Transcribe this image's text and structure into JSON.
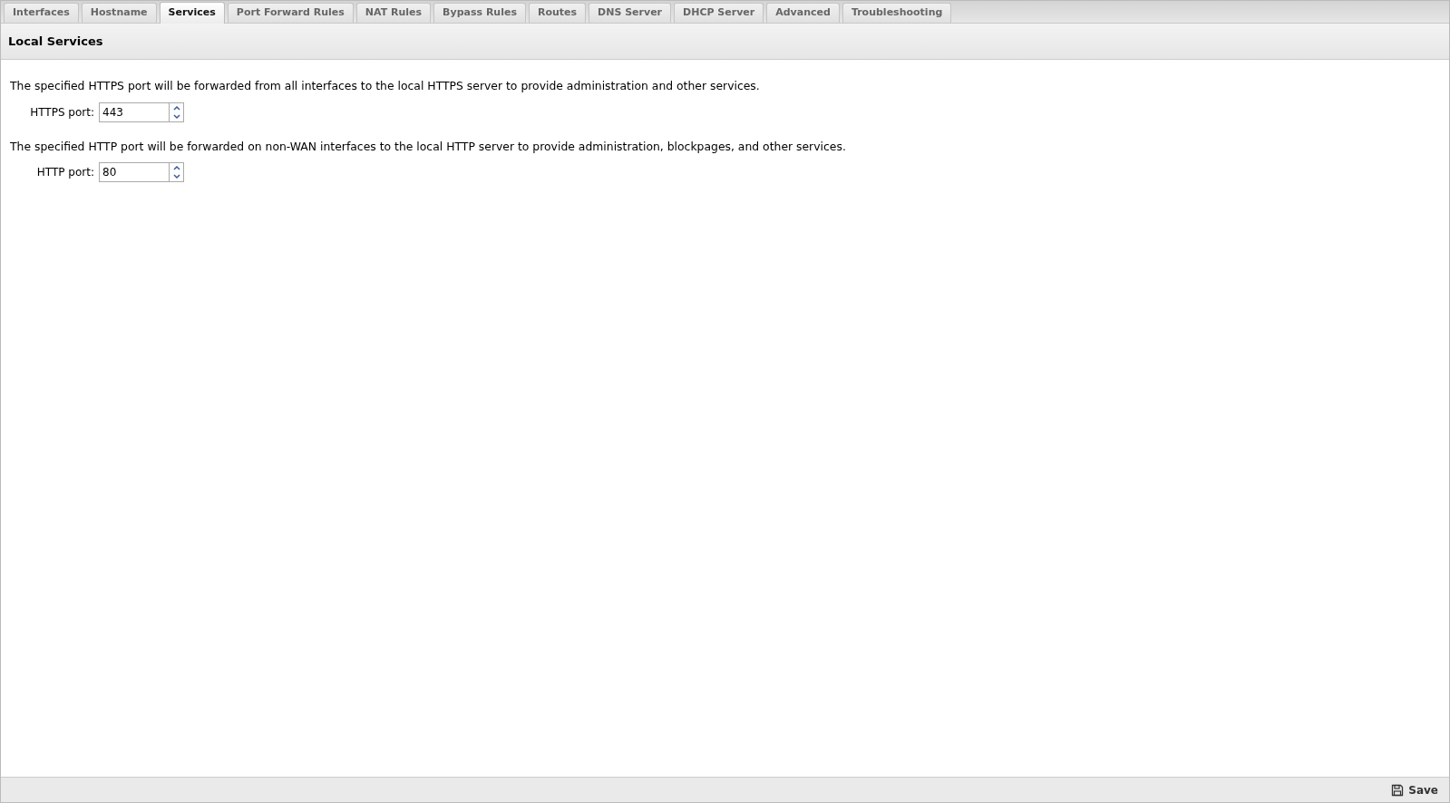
{
  "tabs": [
    {
      "label": "Interfaces",
      "selected": false
    },
    {
      "label": "Hostname",
      "selected": false
    },
    {
      "label": "Services",
      "selected": true
    },
    {
      "label": "Port Forward Rules",
      "selected": false
    },
    {
      "label": "NAT Rules",
      "selected": false
    },
    {
      "label": "Bypass Rules",
      "selected": false
    },
    {
      "label": "Routes",
      "selected": false
    },
    {
      "label": "DNS Server",
      "selected": false
    },
    {
      "label": "DHCP Server",
      "selected": false
    },
    {
      "label": "Advanced",
      "selected": false
    },
    {
      "label": "Troubleshooting",
      "selected": false
    }
  ],
  "panel": {
    "title": "Local Services"
  },
  "settings": [
    {
      "description": "The specified HTTPS port will be forwarded from all interfaces to the local HTTPS server to provide administration and other services.",
      "label": "HTTPS port:",
      "value": "443"
    },
    {
      "description": "The specified HTTP port will be forwarded on non-WAN interfaces to the local HTTP server to provide administration, blockpages, and other services.",
      "label": "HTTP port:",
      "value": "80"
    }
  ],
  "footer": {
    "save_button": "Save"
  }
}
